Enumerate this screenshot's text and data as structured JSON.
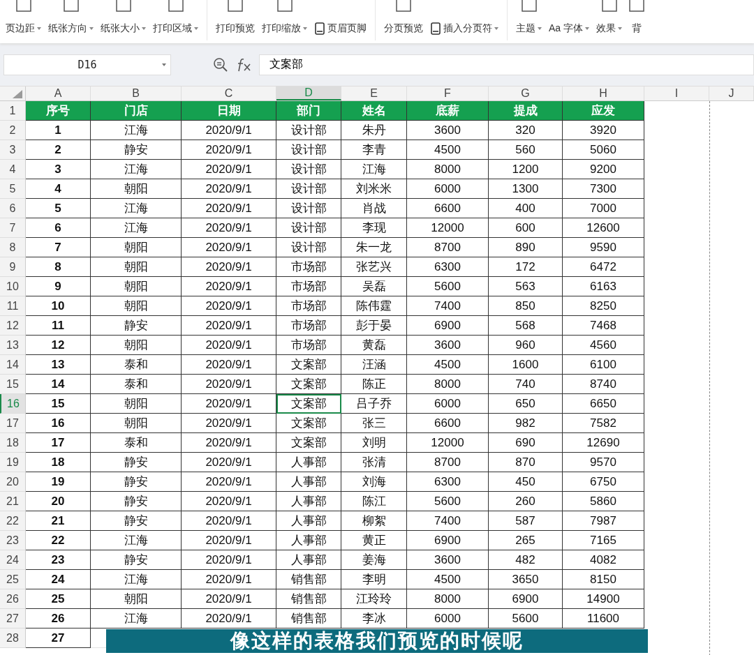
{
  "toolbar": {
    "groups": [
      {
        "items": [
          {
            "kind": "big",
            "label": "页边距",
            "caret": true
          },
          {
            "kind": "big",
            "label": "纸张方向",
            "caret": true
          },
          {
            "kind": "big",
            "label": "纸张大小",
            "caret": true
          },
          {
            "kind": "big",
            "label": "打印区域",
            "caret": true
          }
        ]
      },
      {
        "items": [
          {
            "kind": "big",
            "label": "打印预览",
            "caret": false
          },
          {
            "kind": "big",
            "label": "打印缩放",
            "caret": true
          },
          {
            "kind": "small",
            "label": "页眉页脚",
            "caret": false
          }
        ]
      },
      {
        "items": [
          {
            "kind": "big",
            "label": "分页预览",
            "caret": false
          },
          {
            "kind": "small",
            "label": "插入分页符",
            "caret": true
          }
        ]
      },
      {
        "items": [
          {
            "kind": "big",
            "label": "主题",
            "caret": true
          },
          {
            "kind": "text",
            "label": "Aa 字体",
            "caret": true
          },
          {
            "kind": "big",
            "label": "效果",
            "caret": true
          },
          {
            "kind": "big",
            "label": "背",
            "caret": false
          }
        ]
      }
    ]
  },
  "name_box": "D16",
  "formula": "文案部",
  "columns": [
    {
      "label": "A",
      "selected": false
    },
    {
      "label": "B",
      "selected": false
    },
    {
      "label": "C",
      "selected": false
    },
    {
      "label": "D",
      "selected": true
    },
    {
      "label": "E",
      "selected": false
    },
    {
      "label": "F",
      "selected": false
    },
    {
      "label": "G",
      "selected": false
    },
    {
      "label": "H",
      "selected": false
    },
    {
      "label": "I",
      "selected": false
    },
    {
      "label": "J",
      "selected": false
    }
  ],
  "rows": [
    {
      "number": "1",
      "selected": false,
      "kind": "header",
      "cells": [
        "序号",
        "门店",
        "日期",
        "部门",
        "姓名",
        "底薪",
        "提成",
        "应发"
      ]
    },
    {
      "number": "2",
      "selected": false,
      "kind": "data",
      "cells": [
        "1",
        "江海",
        "2020/9/1",
        "设计部",
        "朱丹",
        "3600",
        "320",
        "3920"
      ]
    },
    {
      "number": "3",
      "selected": false,
      "kind": "data",
      "cells": [
        "2",
        "静安",
        "2020/9/1",
        "设计部",
        "李青",
        "4500",
        "560",
        "5060"
      ]
    },
    {
      "number": "4",
      "selected": false,
      "kind": "data",
      "cells": [
        "3",
        "江海",
        "2020/9/1",
        "设计部",
        "江海",
        "8000",
        "1200",
        "9200"
      ]
    },
    {
      "number": "5",
      "selected": false,
      "kind": "data",
      "cells": [
        "4",
        "朝阳",
        "2020/9/1",
        "设计部",
        "刘米米",
        "6000",
        "1300",
        "7300"
      ]
    },
    {
      "number": "6",
      "selected": false,
      "kind": "data",
      "cells": [
        "5",
        "江海",
        "2020/9/1",
        "设计部",
        "肖战",
        "6600",
        "400",
        "7000"
      ]
    },
    {
      "number": "7",
      "selected": false,
      "kind": "data",
      "cells": [
        "6",
        "江海",
        "2020/9/1",
        "设计部",
        "李现",
        "12000",
        "600",
        "12600"
      ]
    },
    {
      "number": "8",
      "selected": false,
      "kind": "data",
      "cells": [
        "7",
        "朝阳",
        "2020/9/1",
        "设计部",
        "朱一龙",
        "8700",
        "890",
        "9590"
      ]
    },
    {
      "number": "9",
      "selected": false,
      "kind": "data",
      "cells": [
        "8",
        "朝阳",
        "2020/9/1",
        "市场部",
        "张艺兴",
        "6300",
        "172",
        "6472"
      ]
    },
    {
      "number": "10",
      "selected": false,
      "kind": "data",
      "cells": [
        "9",
        "朝阳",
        "2020/9/1",
        "市场部",
        "吴磊",
        "5600",
        "563",
        "6163"
      ]
    },
    {
      "number": "11",
      "selected": false,
      "kind": "data",
      "cells": [
        "10",
        "朝阳",
        "2020/9/1",
        "市场部",
        "陈伟霆",
        "7400",
        "850",
        "8250"
      ]
    },
    {
      "number": "12",
      "selected": false,
      "kind": "data",
      "cells": [
        "11",
        "静安",
        "2020/9/1",
        "市场部",
        "彭于晏",
        "6900",
        "568",
        "7468"
      ]
    },
    {
      "number": "13",
      "selected": false,
      "kind": "data",
      "cells": [
        "12",
        "朝阳",
        "2020/9/1",
        "市场部",
        "黄磊",
        "3600",
        "960",
        "4560"
      ]
    },
    {
      "number": "14",
      "selected": false,
      "kind": "data",
      "cells": [
        "13",
        "泰和",
        "2020/9/1",
        "文案部",
        "汪涵",
        "4500",
        "1600",
        "6100"
      ]
    },
    {
      "number": "15",
      "selected": false,
      "kind": "data",
      "cells": [
        "14",
        "泰和",
        "2020/9/1",
        "文案部",
        "陈正",
        "8000",
        "740",
        "8740"
      ]
    },
    {
      "number": "16",
      "selected": true,
      "kind": "data",
      "cells": [
        "15",
        "朝阳",
        "2020/9/1",
        "文案部",
        "吕子乔",
        "6000",
        "650",
        "6650"
      ]
    },
    {
      "number": "17",
      "selected": false,
      "kind": "data",
      "cells": [
        "16",
        "朝阳",
        "2020/9/1",
        "文案部",
        "张三",
        "6600",
        "982",
        "7582"
      ]
    },
    {
      "number": "18",
      "selected": false,
      "kind": "data",
      "cells": [
        "17",
        "泰和",
        "2020/9/1",
        "文案部",
        "刘明",
        "12000",
        "690",
        "12690"
      ]
    },
    {
      "number": "19",
      "selected": false,
      "kind": "data",
      "cells": [
        "18",
        "静安",
        "2020/9/1",
        "人事部",
        "张清",
        "8700",
        "870",
        "9570"
      ]
    },
    {
      "number": "20",
      "selected": false,
      "kind": "data",
      "cells": [
        "19",
        "静安",
        "2020/9/1",
        "人事部",
        "刘海",
        "6300",
        "450",
        "6750"
      ]
    },
    {
      "number": "21",
      "selected": false,
      "kind": "data",
      "cells": [
        "20",
        "静安",
        "2020/9/1",
        "人事部",
        "陈江",
        "5600",
        "260",
        "5860"
      ]
    },
    {
      "number": "22",
      "selected": false,
      "kind": "data",
      "cells": [
        "21",
        "静安",
        "2020/9/1",
        "人事部",
        "柳絮",
        "7400",
        "587",
        "7987"
      ]
    },
    {
      "number": "23",
      "selected": false,
      "kind": "data",
      "cells": [
        "22",
        "江海",
        "2020/9/1",
        "人事部",
        "黄正",
        "6900",
        "265",
        "7165"
      ]
    },
    {
      "number": "24",
      "selected": false,
      "kind": "data",
      "cells": [
        "23",
        "静安",
        "2020/9/1",
        "人事部",
        "姜海",
        "3600",
        "482",
        "4082"
      ]
    },
    {
      "number": "25",
      "selected": false,
      "kind": "data",
      "cells": [
        "24",
        "江海",
        "2020/9/1",
        "销售部",
        "李明",
        "4500",
        "3650",
        "8150"
      ]
    },
    {
      "number": "26",
      "selected": false,
      "kind": "data",
      "cells": [
        "25",
        "朝阳",
        "2020/9/1",
        "销售部",
        "江玲玲",
        "8000",
        "6900",
        "14900"
      ]
    },
    {
      "number": "27",
      "selected": false,
      "kind": "data",
      "cells": [
        "26",
        "江海",
        "2020/9/1",
        "销售部",
        "李冰",
        "6000",
        "5600",
        "11600"
      ]
    },
    {
      "number": "28",
      "selected": false,
      "kind": "data",
      "cells": [
        "27"
      ]
    }
  ],
  "caption": "像这样的表格我们预览的时候呢"
}
